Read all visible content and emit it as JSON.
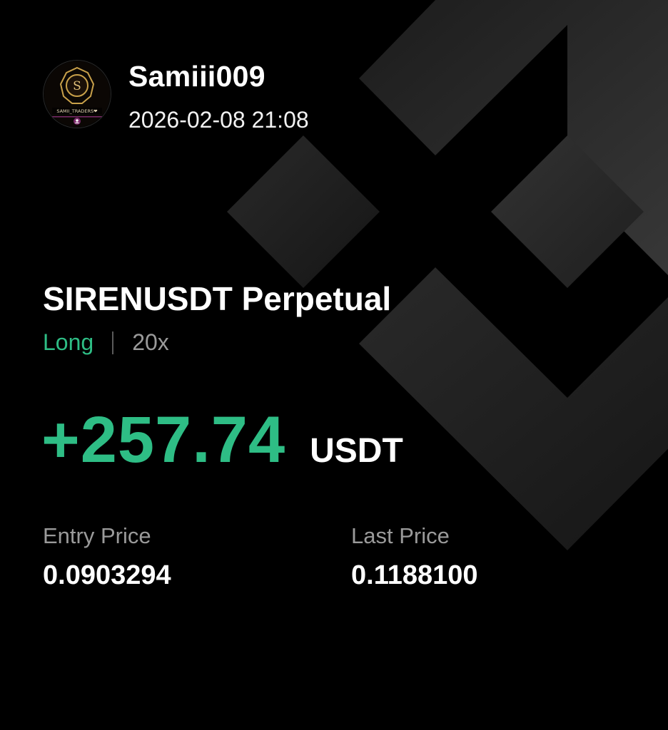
{
  "user": {
    "name": "Samiii009",
    "timestamp": "2026-02-08 21:08",
    "avatar": {
      "monogram": "S",
      "brand_text": "SAMII_TRADERS❤"
    }
  },
  "position": {
    "symbol": "SIRENUSDT Perpetual",
    "side": "Long",
    "leverage": "20x",
    "pnl": "+257.74",
    "pnl_unit": "USDT"
  },
  "prices": {
    "entry_label": "Entry Price",
    "entry_value": "0.0903294",
    "last_label": "Last Price",
    "last_value": "0.1188100"
  },
  "colors": {
    "background": "#000000",
    "profit_green": "#2ebd85",
    "muted_gray": "#9a9a9a",
    "text_white": "#ffffff",
    "logo_gray": "#2a2a2a",
    "avatar_gold": "#c9a14a"
  },
  "icons": {
    "background_logo": "binance-logo-icon",
    "avatar": "user-avatar-icon"
  }
}
